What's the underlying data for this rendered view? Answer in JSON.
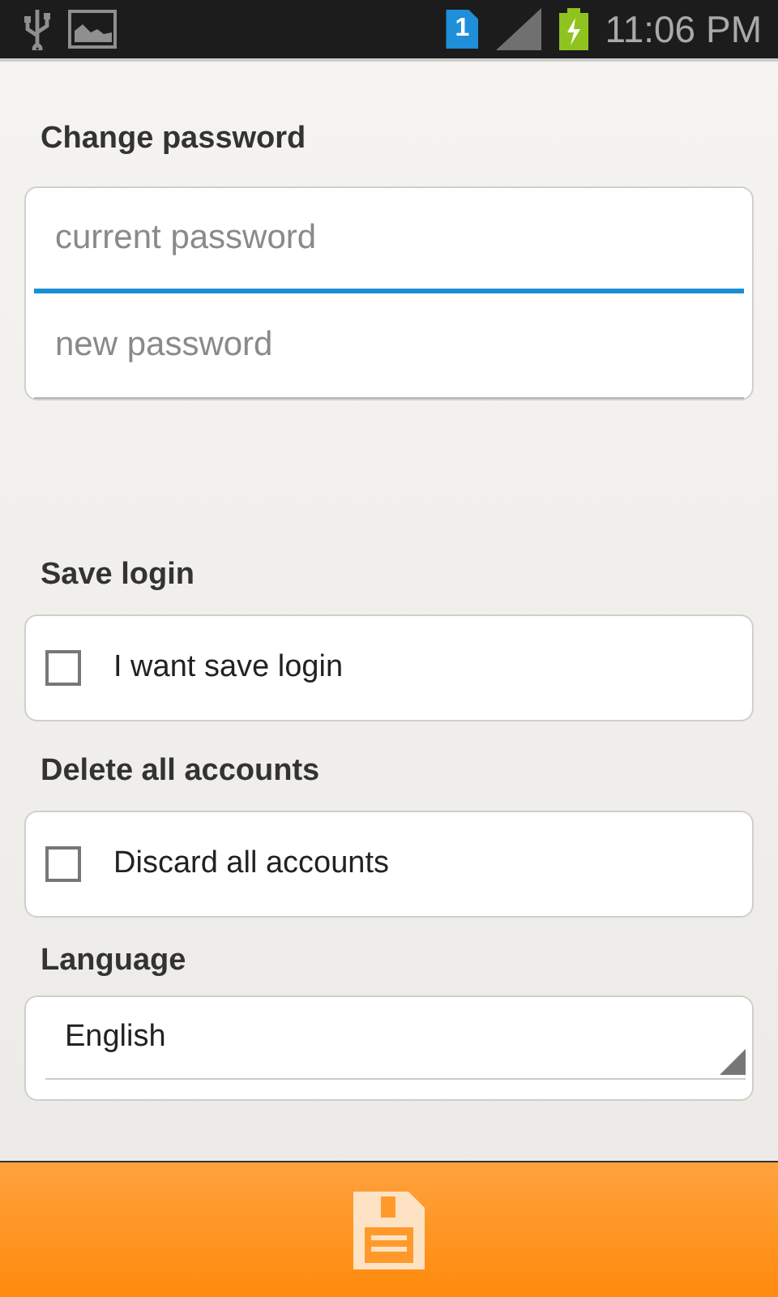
{
  "status_bar": {
    "sim_number": "1",
    "time": "11:06 PM"
  },
  "change_password": {
    "title": "Change password",
    "fields": [
      {
        "placeholder": "current password",
        "focused": true
      },
      {
        "placeholder": "new password",
        "focused": false
      }
    ]
  },
  "options": [
    {
      "title": "Save login",
      "label": "I want save login",
      "checked": false
    },
    {
      "title": "Delete all accounts",
      "label": "Discard all accounts",
      "checked": false
    }
  ],
  "language": {
    "title": "Language",
    "value": "English"
  }
}
